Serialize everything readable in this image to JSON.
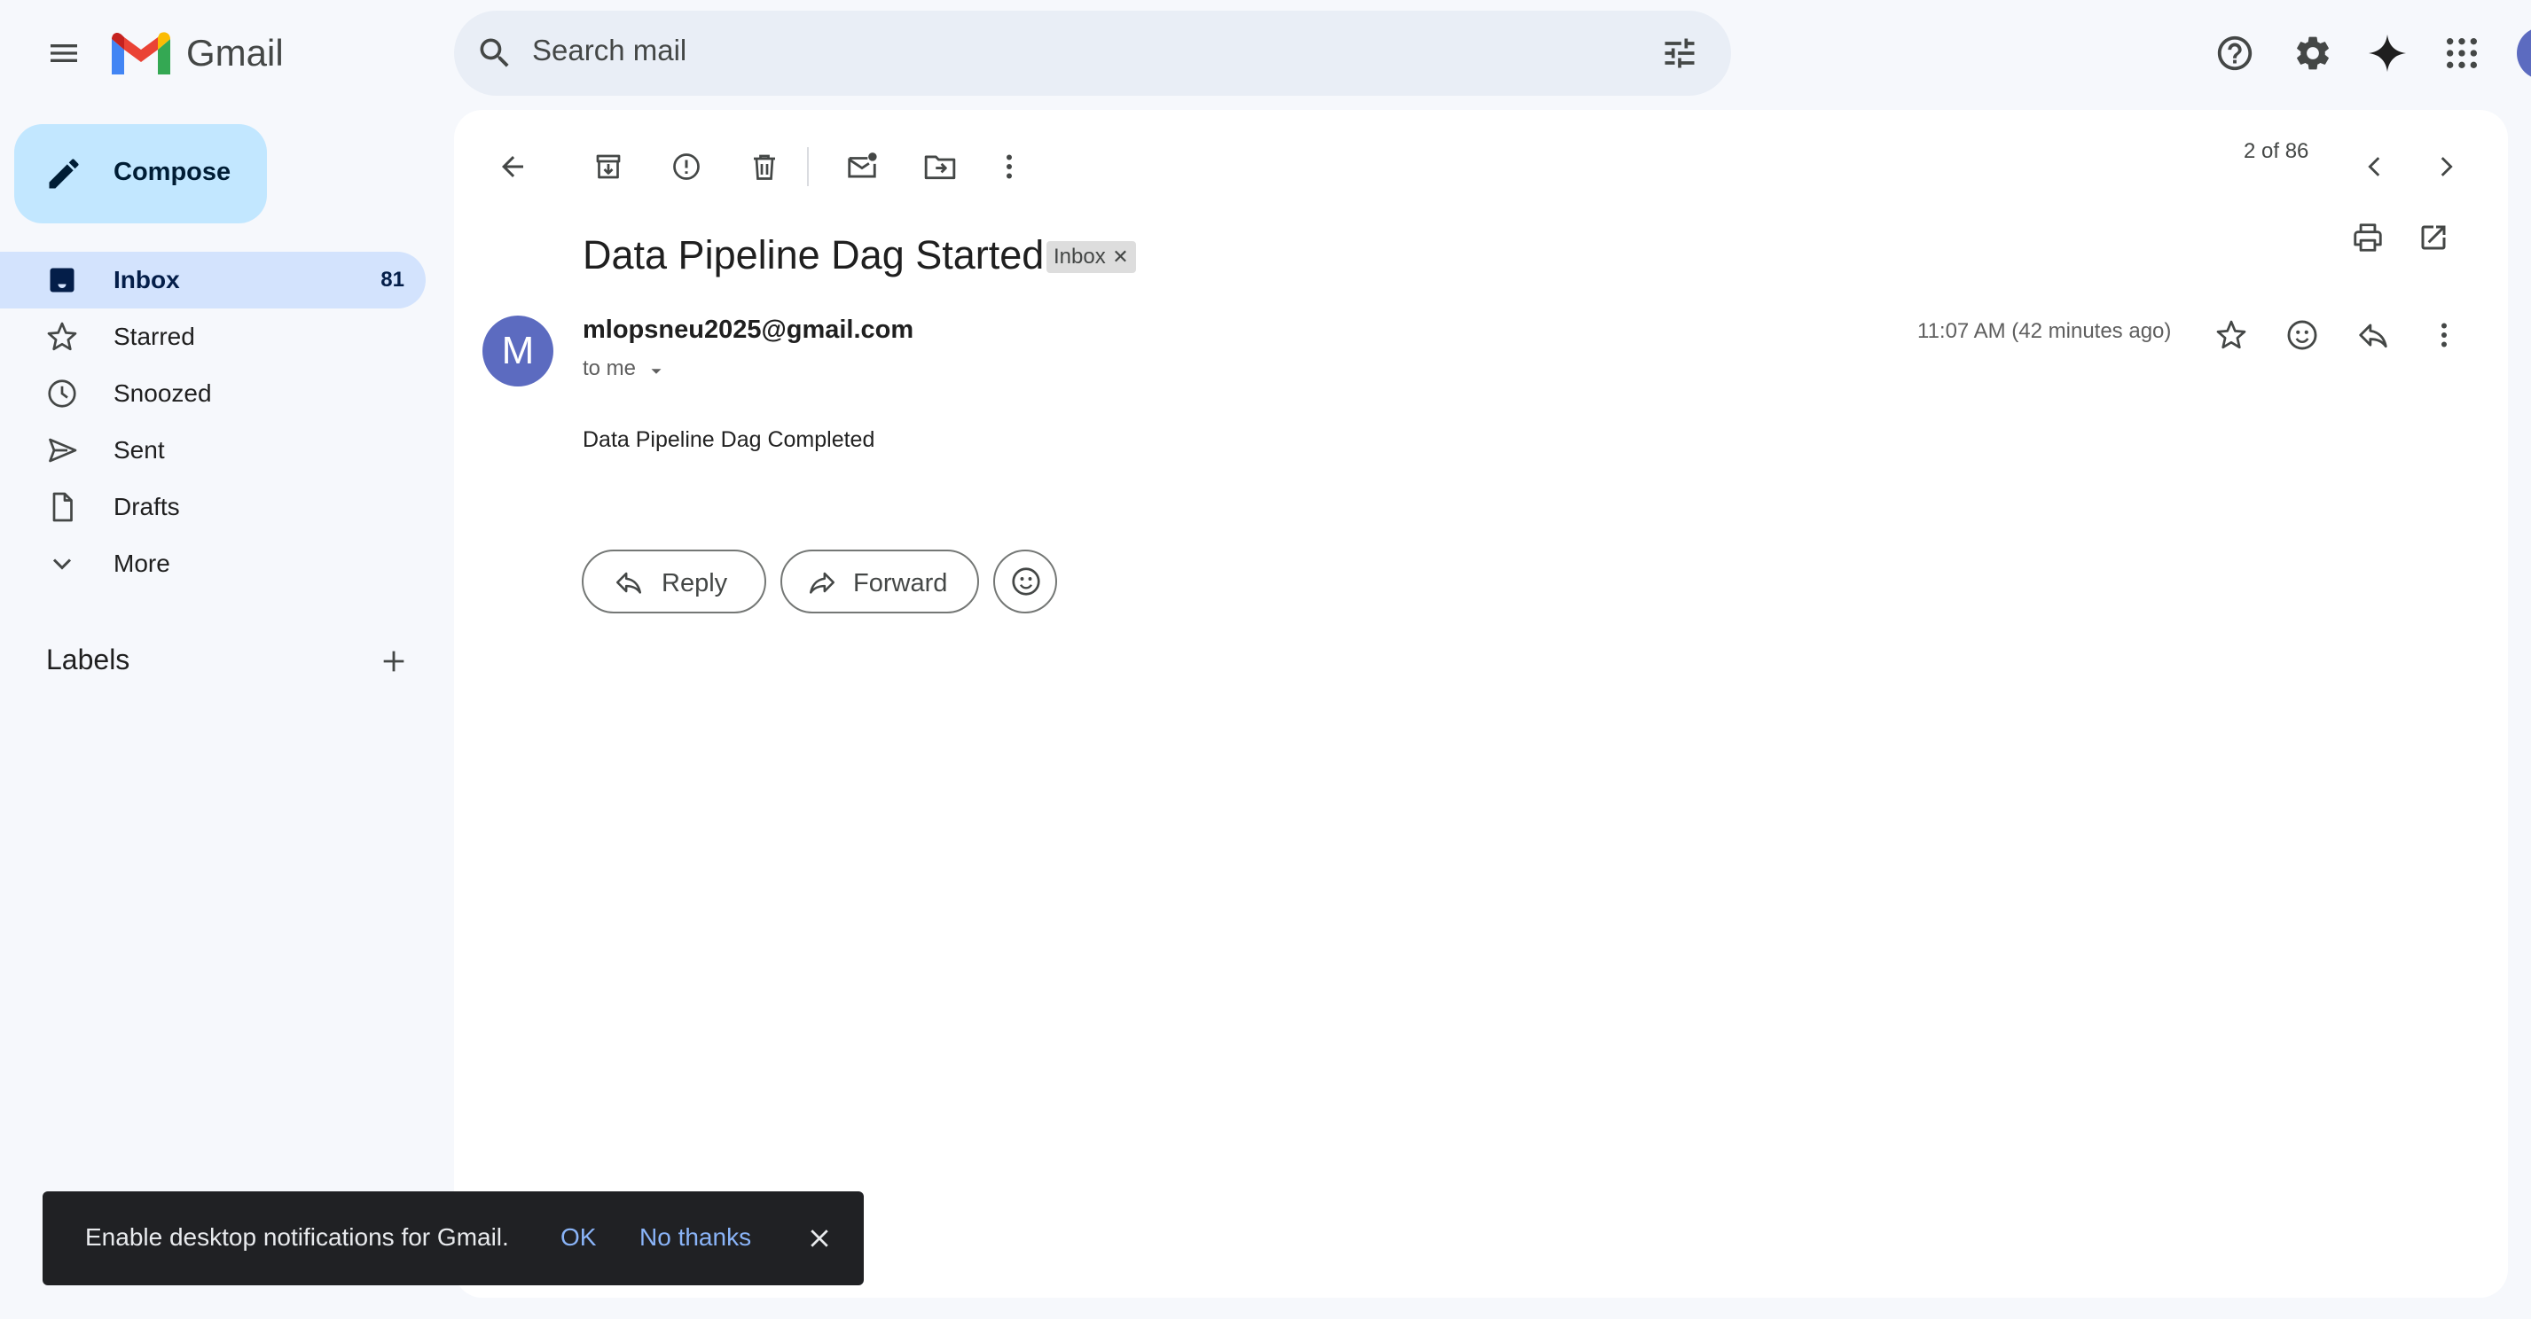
{
  "app": {
    "name": "Gmail"
  },
  "search": {
    "placeholder": "Search mail"
  },
  "sidebar": {
    "compose_label": "Compose",
    "items": [
      {
        "label": "Inbox",
        "count": "81",
        "icon": "inbox-icon",
        "active": true
      },
      {
        "label": "Starred",
        "icon": "star-icon"
      },
      {
        "label": "Snoozed",
        "icon": "clock-icon"
      },
      {
        "label": "Sent",
        "icon": "send-icon"
      },
      {
        "label": "Drafts",
        "icon": "draft-icon"
      },
      {
        "label": "More",
        "icon": "chevron-down-icon"
      }
    ],
    "labels_heading": "Labels"
  },
  "toolbar": {
    "page_count": "2 of 86"
  },
  "email": {
    "subject": "Data Pipeline Dag Started",
    "label_chip": "Inbox",
    "sender": "mlopsneu2025@gmail.com",
    "avatar_letter": "M",
    "recipient": "to me",
    "time": "11:07 AM (42 minutes ago)",
    "body": "Data Pipeline Dag Completed"
  },
  "actions": {
    "reply_label": "Reply",
    "forward_label": "Forward"
  },
  "snackbar": {
    "message": "Enable desktop notifications for Gmail.",
    "ok_label": "OK",
    "dismiss_label": "No thanks"
  },
  "colors": {
    "background": "#f6f8fc",
    "compose": "#c2e7ff",
    "active_nav": "#d3e3fd",
    "search": "#e9eef6",
    "avatar": "#5c6bc0",
    "snackbar": "#202124",
    "snackbar_action": "#8ab4f8"
  }
}
